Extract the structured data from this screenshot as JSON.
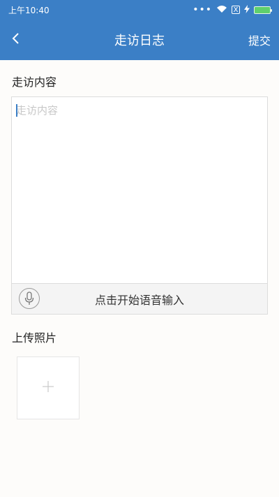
{
  "status_bar": {
    "time": "上午10:40",
    "sim_label": "X",
    "battery_color": "#5fd06d"
  },
  "header": {
    "title": "走访日志",
    "submit_label": "提交",
    "back_icon": "chevron-left-icon",
    "background_color": "#3b7fc6"
  },
  "visit_content": {
    "label": "走访内容",
    "placeholder": "走访内容",
    "value": "",
    "voice_input_label": "点击开始语音输入",
    "mic_icon": "microphone-icon"
  },
  "photos": {
    "label": "上传照片",
    "add_icon": "plus-icon"
  }
}
